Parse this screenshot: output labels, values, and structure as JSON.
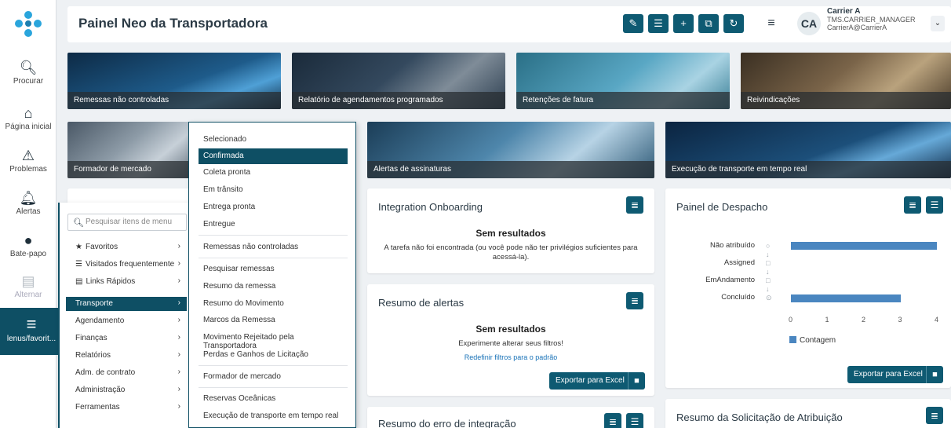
{
  "colors": {
    "primary": "#0e5a72",
    "rail_active": "#0e4f64",
    "bar": "#4a86c0",
    "link": "#1a73b8"
  },
  "rail": {
    "items": [
      {
        "label": "Procurar",
        "icon": "search-icon"
      },
      {
        "label": "Página inicial",
        "icon": "home-icon"
      },
      {
        "label": "Problemas",
        "icon": "warning-icon"
      },
      {
        "label": "Alertas",
        "icon": "bell-icon"
      },
      {
        "label": "Bate-papo",
        "icon": "chat-icon"
      },
      {
        "label": "Alternar",
        "icon": "switch-icon"
      }
    ],
    "active_label": "lenus/favorit..."
  },
  "header": {
    "title": "Painel Neo da Transportadora",
    "avatar": "CA",
    "user_name": "Carrier A",
    "user_role": "TMS.CARRIER_MANAGER",
    "user_email": "CarrierA@CarrierA"
  },
  "tiles": [
    "Remessas não controladas",
    "Relatório de agendamentos programados",
    "Retenções de fatura",
    "Reivindicações",
    "Formador de mercado",
    "Alertas de assinaturas",
    "Execução de transporte em tempo real"
  ],
  "cards": {
    "integration": {
      "title": "Integration Onboarding",
      "empty_title": "Sem resultados",
      "empty_msg": "A tarefa não foi encontrada (ou você pode não ter privilégios suficientes para acessá-la)."
    },
    "alerts": {
      "title": "Resumo de alertas",
      "empty_title": "Sem resultados",
      "empty_msg": "Experimente alterar seus filtros!",
      "reset_link": "Redefinir filtros para o padrão",
      "export": "Exportar para Excel"
    },
    "integration_error": {
      "title": "Resumo do erro de integração"
    },
    "dispatch": {
      "title": "Painel de Despacho",
      "export": "Exportar para Excel"
    },
    "assignment": {
      "title": "Resumo da Solicitação de Atribuição"
    }
  },
  "chart_data": {
    "type": "bar",
    "orientation": "horizontal",
    "categories": [
      "Não atribuído",
      "Assigned",
      "EmAndamento",
      "Concluído"
    ],
    "series": [
      {
        "name": "Contagem",
        "values": [
          4,
          0,
          0,
          3
        ]
      }
    ],
    "xticks": [
      "0",
      "1",
      "2",
      "3",
      "4"
    ],
    "xlim": [
      0,
      4
    ],
    "legend": "bottom"
  },
  "menu": {
    "search_placeholder": "Pesquisar itens de menu",
    "items": [
      {
        "label": "Favoritos",
        "icon": "star-icon"
      },
      {
        "label": "Visitados frequentemente",
        "icon": "list-icon"
      },
      {
        "label": "Links Rápidos",
        "icon": "link-list-icon"
      },
      {
        "label": "Transporte"
      },
      {
        "label": "Agendamento"
      },
      {
        "label": "Finanças"
      },
      {
        "label": "Relatórios"
      },
      {
        "label": "Adm. de contrato"
      },
      {
        "label": "Administração"
      },
      {
        "label": "Ferramentas"
      }
    ],
    "submenu": [
      "Selecionado",
      "Confirmada",
      "Coleta pronta",
      "Em trânsito",
      "Entrega pronta",
      "Entregue",
      "Remessas não controladas",
      "Pesquisar remessas",
      "Resumo da remessa",
      "Resumo do Movimento",
      "Marcos da Remessa",
      "Movimento Rejeitado pela Transportadora",
      "Perdas e Ganhos de Licitação",
      "Formador de mercado",
      "Reservas Oceânicas",
      "Execução de transporte em tempo real"
    ]
  }
}
